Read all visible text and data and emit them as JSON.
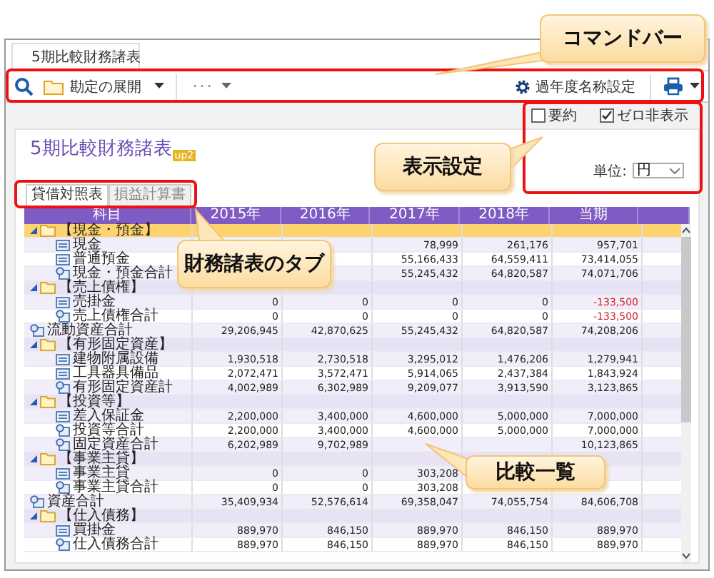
{
  "document_tab": {
    "title": "5期比較財務諸表"
  },
  "command_bar": {
    "expand_button": "勘定の展開",
    "more_button": "･･･",
    "settings_button": "過年度名称設定"
  },
  "display_options": [
    {
      "label": "要約",
      "checked": false
    },
    {
      "label": "ゼロ非表示",
      "checked": true
    }
  ],
  "report": {
    "title": "5期比較財務諸表",
    "badge": "up2",
    "unit_label": "単位:",
    "unit_value": "円"
  },
  "statement_tabs": [
    {
      "label": "貸借対照表",
      "selected": true
    },
    {
      "label": "損益計算書",
      "selected": false
    }
  ],
  "table": {
    "columns": [
      "科目",
      "2015年",
      "2016年",
      "2017年",
      "2018年",
      "当期"
    ],
    "rows": [
      {
        "kind": "group",
        "name": "【現金・預金】",
        "selected": true,
        "expanded": true,
        "children": [
          {
            "kind": "account",
            "name": "現金",
            "cells": {
              "y2017": {
                "text": "78,999",
                "negative": false
              },
              "y2018": {
                "text": "261,176",
                "negative": false
              },
              "current": {
                "text": "957,701",
                "negative": false
              }
            }
          },
          {
            "kind": "account",
            "name": "普通預金",
            "cells": {
              "y2017": {
                "text": "55,166,433",
                "negative": false
              },
              "y2018": {
                "text": "64,559,411",
                "negative": false
              },
              "current": {
                "text": "73,414,055",
                "negative": false
              }
            }
          },
          {
            "kind": "total",
            "name": "現金・預金合計",
            "cells": {
              "y2017": {
                "text": "55,245,432",
                "negative": false
              },
              "y2018": {
                "text": "64,820,587",
                "negative": false
              },
              "current": {
                "text": "74,071,706",
                "negative": false
              }
            }
          }
        ]
      },
      {
        "kind": "group",
        "name": "【売上債権】",
        "selected": false,
        "expanded": true,
        "children": [
          {
            "kind": "account",
            "name": "売掛金",
            "cells": {
              "y2015": {
                "text": "0",
                "negative": false
              },
              "y2016": {
                "text": "0",
                "negative": false
              },
              "y2017": {
                "text": "0",
                "negative": false
              },
              "y2018": {
                "text": "0",
                "negative": false
              },
              "current": {
                "text": "-133,500",
                "negative": true
              }
            }
          },
          {
            "kind": "total",
            "name": "売上債権合計",
            "cells": {
              "y2015": {
                "text": "0",
                "negative": false
              },
              "y2016": {
                "text": "0",
                "negative": false
              },
              "y2017": {
                "text": "0",
                "negative": false
              },
              "y2018": {
                "text": "0",
                "negative": false
              },
              "current": {
                "text": "-133,500",
                "negative": true
              }
            }
          }
        ]
      },
      {
        "kind": "total",
        "name": "流動資産合計",
        "cells": {
          "y2015": {
            "text": "29,206,945",
            "negative": false
          },
          "y2016": {
            "text": "42,870,625",
            "negative": false
          },
          "y2017": {
            "text": "55,245,432",
            "negative": false
          },
          "y2018": {
            "text": "64,820,587",
            "negative": false
          },
          "current": {
            "text": "74,208,206",
            "negative": false
          }
        }
      },
      {
        "kind": "group",
        "name": "【有形固定資産】",
        "selected": false,
        "expanded": true,
        "children": [
          {
            "kind": "account",
            "name": "建物附属設備",
            "cells": {
              "y2015": {
                "text": "1,930,518",
                "negative": false
              },
              "y2016": {
                "text": "2,730,518",
                "negative": false
              },
              "y2017": {
                "text": "3,295,012",
                "negative": false
              },
              "y2018": {
                "text": "1,476,206",
                "negative": false
              },
              "current": {
                "text": "1,279,941",
                "negative": false
              }
            }
          },
          {
            "kind": "account",
            "name": "工具器具備品",
            "cells": {
              "y2015": {
                "text": "2,072,471",
                "negative": false
              },
              "y2016": {
                "text": "3,572,471",
                "negative": false
              },
              "y2017": {
                "text": "5,914,065",
                "negative": false
              },
              "y2018": {
                "text": "2,437,384",
                "negative": false
              },
              "current": {
                "text": "1,843,924",
                "negative": false
              }
            }
          },
          {
            "kind": "total",
            "name": "有形固定資産計",
            "cells": {
              "y2015": {
                "text": "4,002,989",
                "negative": false
              },
              "y2016": {
                "text": "6,302,989",
                "negative": false
              },
              "y2017": {
                "text": "9,209,077",
                "negative": false
              },
              "y2018": {
                "text": "3,913,590",
                "negative": false
              },
              "current": {
                "text": "3,123,865",
                "negative": false
              }
            }
          }
        ]
      },
      {
        "kind": "group",
        "name": "【投資等】",
        "selected": false,
        "expanded": true,
        "children": [
          {
            "kind": "account",
            "name": "差入保証金",
            "cells": {
              "y2015": {
                "text": "2,200,000",
                "negative": false
              },
              "y2016": {
                "text": "3,400,000",
                "negative": false
              },
              "y2017": {
                "text": "4,600,000",
                "negative": false
              },
              "y2018": {
                "text": "5,000,000",
                "negative": false
              },
              "current": {
                "text": "7,000,000",
                "negative": false
              }
            }
          },
          {
            "kind": "total",
            "name": "投資等合計",
            "cells": {
              "y2015": {
                "text": "2,200,000",
                "negative": false
              },
              "y2016": {
                "text": "3,400,000",
                "negative": false
              },
              "y2017": {
                "text": "4,600,000",
                "negative": false
              },
              "y2018": {
                "text": "5,000,000",
                "negative": false
              },
              "current": {
                "text": "7,000,000",
                "negative": false
              }
            }
          },
          {
            "kind": "total",
            "name": "固定資産合計",
            "cells": {
              "y2015": {
                "text": "6,202,989",
                "negative": false
              },
              "y2016": {
                "text": "9,702,989",
                "negative": false
              },
              "current": {
                "text": "10,123,865",
                "negative": false
              }
            }
          }
        ]
      },
      {
        "kind": "group",
        "name": "【事業主貸】",
        "selected": false,
        "expanded": true,
        "children": [
          {
            "kind": "account",
            "name": "事業主貸",
            "cells": {
              "y2015": {
                "text": "0",
                "negative": false
              },
              "y2016": {
                "text": "0",
                "negative": false
              },
              "y2017": {
                "text": "303,208",
                "negative": false
              }
            }
          },
          {
            "kind": "total",
            "name": "事業主貸合計",
            "cells": {
              "y2015": {
                "text": "0",
                "negative": false
              },
              "y2016": {
                "text": "0",
                "negative": false
              },
              "y2017": {
                "text": "303,208",
                "negative": false
              }
            }
          }
        ]
      },
      {
        "kind": "total",
        "name": "資産合計",
        "cells": {
          "y2015": {
            "text": "35,409,934",
            "negative": false
          },
          "y2016": {
            "text": "52,576,614",
            "negative": false
          },
          "y2017": {
            "text": "69,358,047",
            "negative": false
          },
          "y2018": {
            "text": "74,055,754",
            "negative": false
          },
          "current": {
            "text": "84,606,708",
            "negative": false
          }
        }
      },
      {
        "kind": "group",
        "name": "【仕入債務】",
        "selected": false,
        "expanded": true,
        "children": [
          {
            "kind": "account",
            "name": "買掛金",
            "cells": {
              "y2015": {
                "text": "889,970",
                "negative": false
              },
              "y2016": {
                "text": "846,150",
                "negative": false
              },
              "y2017": {
                "text": "889,970",
                "negative": false
              },
              "y2018": {
                "text": "846,150",
                "negative": false
              },
              "current": {
                "text": "889,970",
                "negative": false
              }
            }
          },
          {
            "kind": "total",
            "name": "仕入債務合計",
            "cells": {
              "y2015": {
                "text": "889,970",
                "negative": false
              },
              "y2016": {
                "text": "846,150",
                "negative": false
              },
              "y2017": {
                "text": "889,970",
                "negative": false
              },
              "y2018": {
                "text": "846,150",
                "negative": false
              },
              "current": {
                "text": "889,970",
                "negative": false
              }
            }
          }
        ]
      }
    ]
  },
  "callouts": [
    {
      "text": "コマンドバー"
    },
    {
      "text": "表示設定"
    },
    {
      "text": "財務諸表のタブ"
    },
    {
      "text": "比較一覧"
    }
  ]
}
